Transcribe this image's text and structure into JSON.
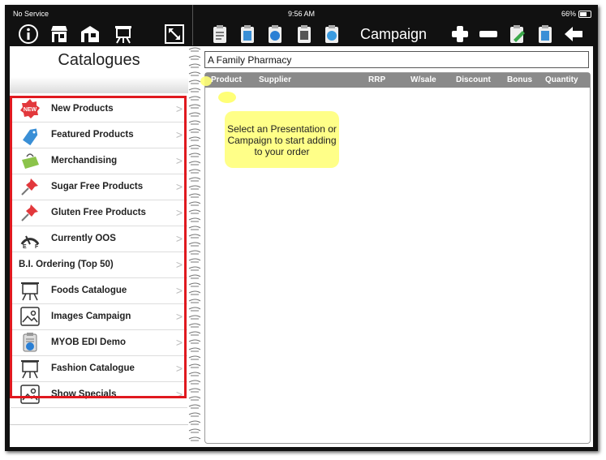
{
  "status_bar": {
    "carrier": "No Service",
    "time": "9:56 AM",
    "battery": "66%"
  },
  "toolbar": {
    "title": "Campaign",
    "left_icons": [
      "info-icon",
      "shop-icon",
      "store-icon",
      "easel-icon",
      "resize-icon"
    ],
    "right_icons": [
      "order-clipboard-icon",
      "doc-clipboard-icon",
      "sale-clipboard-icon",
      "calc-clipboard-icon",
      "sync-clipboard-icon"
    ],
    "action_icons": [
      "add-icon",
      "remove-icon",
      "edit-clipboard-icon",
      "copy-clipboard-icon",
      "back-arrow-icon"
    ]
  },
  "sidebar": {
    "title": "Catalogues",
    "items": [
      {
        "label": "New Products",
        "icon": "new-badge-icon"
      },
      {
        "label": "Featured Products",
        "icon": "tag-icon"
      },
      {
        "label": "Merchandising",
        "icon": "bag-icon"
      },
      {
        "label": "Sugar Free Products",
        "icon": "pushpin-icon"
      },
      {
        "label": "Gluten Free Products",
        "icon": "pushpin-icon"
      },
      {
        "label": "Currently OOS",
        "icon": "fuel-gauge-icon"
      },
      {
        "label": "B.I. Ordering (Top 50)",
        "icon": ""
      },
      {
        "label": "Foods Catalogue",
        "icon": "easel-icon"
      },
      {
        "label": "Images Campaign",
        "icon": "image-icon"
      },
      {
        "label": "MYOB EDI Demo",
        "icon": "sale-clipboard-icon"
      },
      {
        "label": "Fashion Catalogue",
        "icon": "easel-icon"
      },
      {
        "label": "Show Specials",
        "icon": "image-icon"
      }
    ]
  },
  "main": {
    "customer_name": "A Family Pharmacy",
    "columns": [
      "Product",
      "Supplier",
      "RRP",
      "W/sale",
      "Discount",
      "Bonus",
      "Quantity"
    ],
    "hint": "Select an Presentation or Campaign to start adding to your order"
  },
  "colors": {
    "highlight_box": "#e0191f",
    "hint_bubble": "#ffff88",
    "table_header": "#8a8a8a"
  }
}
